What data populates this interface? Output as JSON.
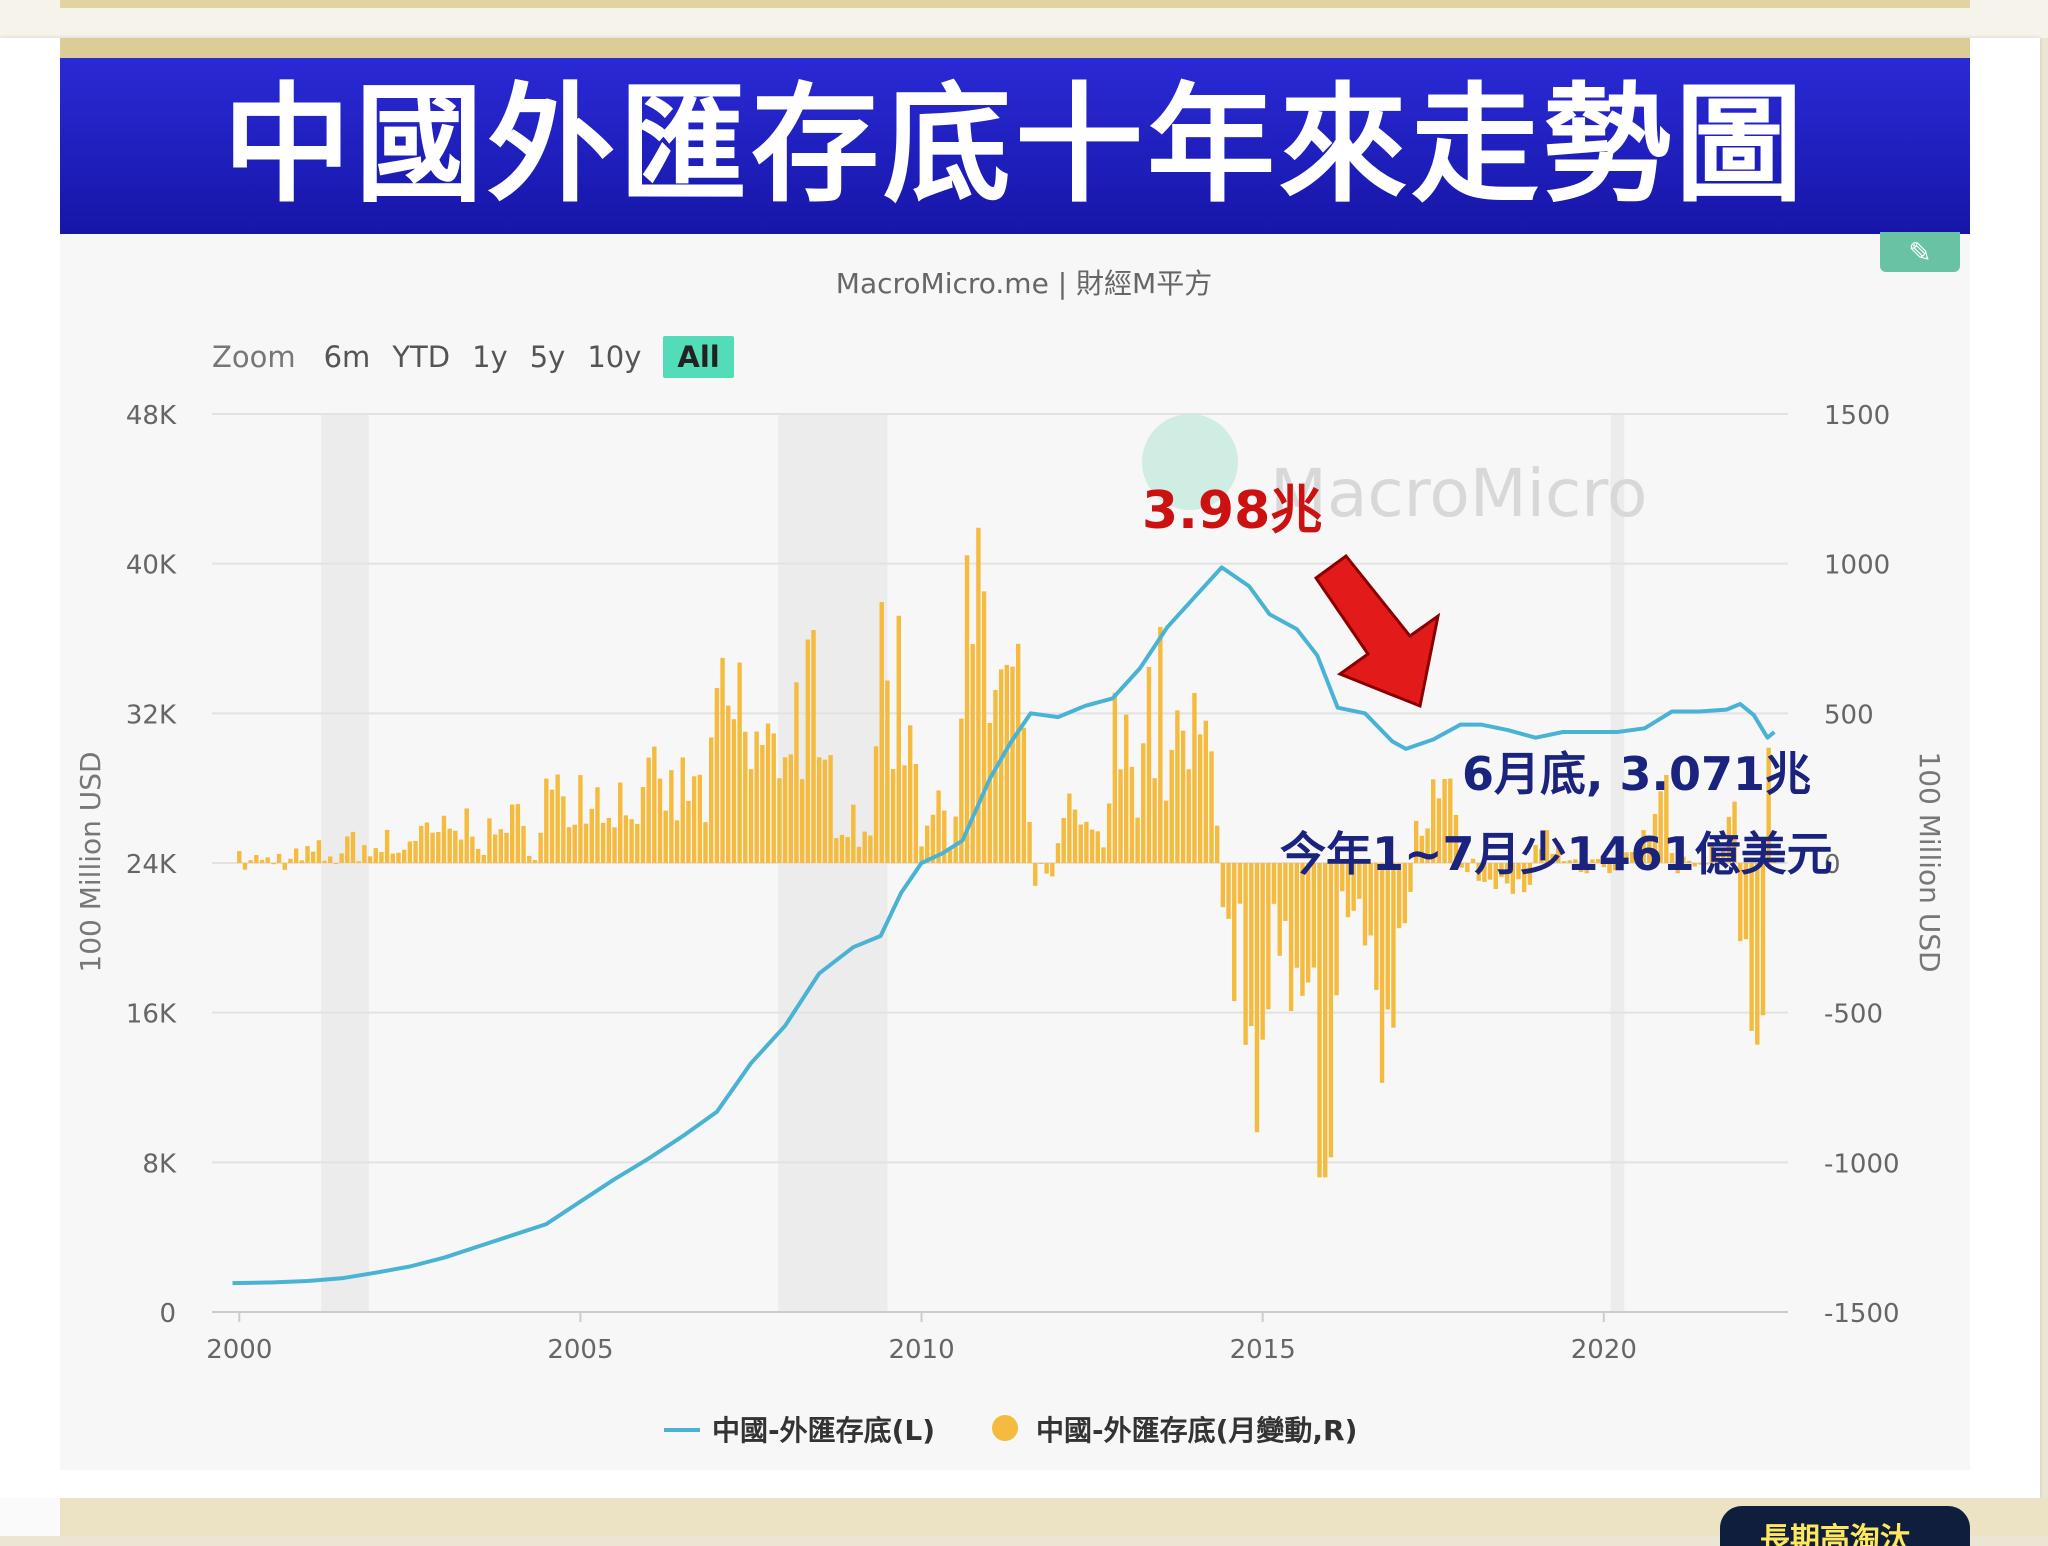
{
  "banner": {
    "title": "中國外匯存底十年來走勢圖"
  },
  "source": "MacroMicro.me | 財經M平方",
  "zoom": {
    "label": "Zoom",
    "options": [
      "6m",
      "YTD",
      "1y",
      "5y",
      "10y",
      "All"
    ],
    "active": "All"
  },
  "bottom_pill": "長期高淘汰",
  "colors": {
    "line": "#4ab3d4",
    "bar": "#f5bb3e",
    "banner": "#1f1fc0",
    "peak_label": "#cc1111",
    "annotation": "#1a237e",
    "arrow": "#e31a1a"
  },
  "chart_data": {
    "type": "line+bar",
    "watermark": "MacroMicro",
    "left_axis": {
      "title": "100 Million USD",
      "ticks": [
        "0",
        "8K",
        "16K",
        "24K",
        "32K",
        "40K",
        "48K"
      ],
      "range": [
        0,
        48000
      ]
    },
    "right_axis": {
      "title": "100 Million USD",
      "ticks": [
        "-1500",
        "-1000",
        "-500",
        "0",
        "500",
        "1000",
        "1500"
      ],
      "range": [
        -1500,
        1500
      ]
    },
    "x_axis": {
      "ticks": [
        "2000",
        "2005",
        "2010",
        "2015",
        "2020"
      ],
      "range": [
        1999.6,
        2022.7
      ]
    },
    "recession_bands": [
      [
        2001.2,
        2001.9
      ],
      [
        2007.9,
        2009.5
      ],
      [
        2020.1,
        2020.3
      ]
    ],
    "series": [
      {
        "name": "中國-外匯存底(L)",
        "type": "line",
        "axis": "left",
        "points": [
          [
            1999.9,
            1547
          ],
          [
            2000.5,
            1580
          ],
          [
            2001.0,
            1656
          ],
          [
            2001.5,
            1800
          ],
          [
            2002.0,
            2100
          ],
          [
            2002.5,
            2430
          ],
          [
            2003.0,
            2900
          ],
          [
            2003.5,
            3500
          ],
          [
            2004.0,
            4100
          ],
          [
            2004.5,
            4700
          ],
          [
            2005.0,
            5900
          ],
          [
            2005.5,
            7100
          ],
          [
            2006.0,
            8200
          ],
          [
            2006.5,
            9400
          ],
          [
            2007.0,
            10700
          ],
          [
            2007.5,
            13300
          ],
          [
            2008.0,
            15300
          ],
          [
            2008.5,
            18100
          ],
          [
            2009.0,
            19500
          ],
          [
            2009.4,
            20100
          ],
          [
            2009.7,
            22400
          ],
          [
            2010.0,
            24000
          ],
          [
            2010.3,
            24500
          ],
          [
            2010.6,
            25200
          ],
          [
            2011.0,
            28500
          ],
          [
            2011.3,
            30400
          ],
          [
            2011.6,
            32000
          ],
          [
            2012.0,
            31800
          ],
          [
            2012.4,
            32400
          ],
          [
            2012.8,
            32800
          ],
          [
            2013.2,
            34400
          ],
          [
            2013.6,
            36600
          ],
          [
            2014.0,
            38200
          ],
          [
            2014.4,
            39800
          ],
          [
            2014.8,
            38800
          ],
          [
            2015.1,
            37300
          ],
          [
            2015.5,
            36500
          ],
          [
            2015.8,
            35100
          ],
          [
            2016.1,
            32300
          ],
          [
            2016.5,
            32000
          ],
          [
            2016.9,
            30500
          ],
          [
            2017.1,
            30100
          ],
          [
            2017.5,
            30600
          ],
          [
            2017.9,
            31400
          ],
          [
            2018.2,
            31400
          ],
          [
            2018.6,
            31100
          ],
          [
            2019.0,
            30700
          ],
          [
            2019.4,
            31000
          ],
          [
            2019.8,
            31000
          ],
          [
            2020.2,
            31000
          ],
          [
            2020.6,
            31200
          ],
          [
            2021.0,
            32100
          ],
          [
            2021.4,
            32100
          ],
          [
            2021.8,
            32200
          ],
          [
            2022.0,
            32500
          ],
          [
            2022.2,
            31900
          ],
          [
            2022.4,
            30700
          ],
          [
            2022.5,
            31000
          ]
        ]
      },
      {
        "name": "中國-外匯存底(月變動,R)",
        "type": "bar",
        "axis": "right"
      }
    ],
    "annotations": [
      {
        "id": "peak",
        "text": "3.98兆"
      },
      {
        "id": "latest",
        "text": "6月底, 3.071兆"
      },
      {
        "id": "ytd",
        "text": "今年1~7月少1461億美元"
      }
    ],
    "legend": [
      "中國-外匯存底(L)",
      "中國-外匯存底(月變動,R)"
    ]
  }
}
